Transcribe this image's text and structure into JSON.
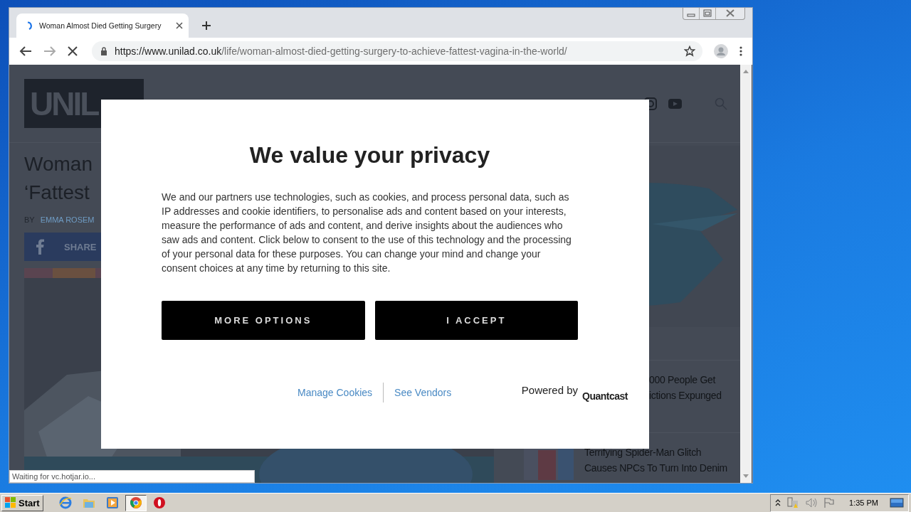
{
  "browser": {
    "tabs": [
      {
        "title": "Woman Almost Died Getting Surgery",
        "selected": true,
        "loading": true
      }
    ],
    "url": {
      "host": "https://www.unilad.co.uk",
      "path": "/life/woman-almost-died-getting-surgery-to-achieve-fattest-vagina-in-the-world/"
    },
    "status": "Waiting for vc.hotjar.io..."
  },
  "page": {
    "logo": "UNIL",
    "headline": [
      "Woman",
      "‘Fattest"
    ],
    "byline_prefix": "BY",
    "author": "EMMA ROSEM",
    "share": "SHARE",
    "sidebar": [
      {
        "lines": [
          "000 People Get",
          "ictions Expunged"
        ],
        "covered": true
      },
      {
        "lines": [
          "Terrifying Spider-Man Glitch",
          "Causes NPCs To Turn Into Denim"
        ],
        "covered": false
      }
    ]
  },
  "dialog": {
    "title": "We value your privacy",
    "body": "We and our partners use technologies, such as cookies, and process personal data, such as IP addresses and cookie identifiers, to personalise ads and content based on your interests, measure the performance of ads and content, and derive insights about the audiences who saw ads and content. Click below to consent to the use of this technology and the processing of your personal data for these purposes. You can change your mind and change your consent choices at any time by returning to this site.",
    "buttons": [
      "MORE OPTIONS",
      "I ACCEPT"
    ],
    "links": [
      "Manage Cookies",
      "See Vendors"
    ],
    "powered_by": "Powered by",
    "brand": "Quantcast"
  },
  "taskbar": {
    "start": "Start",
    "apps": [
      {
        "kind": "ie",
        "selected": false
      },
      {
        "kind": "folder",
        "selected": false
      },
      {
        "kind": "media",
        "selected": false
      },
      {
        "kind": "chrome",
        "selected": true
      },
      {
        "kind": "opera",
        "selected": false
      }
    ],
    "clock": "1:35 PM"
  }
}
